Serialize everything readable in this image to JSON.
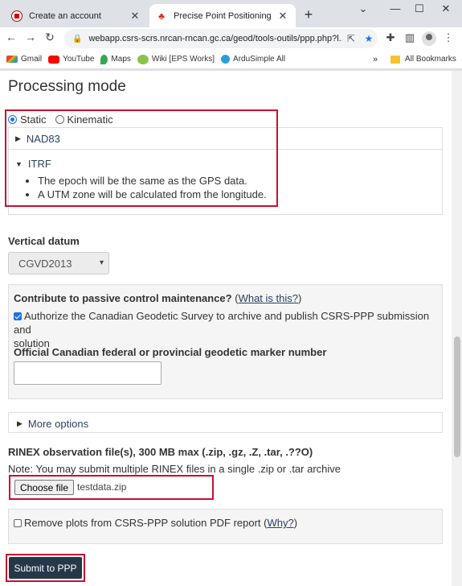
{
  "browser": {
    "tabs": [
      {
        "title": "Create an account"
      },
      {
        "title": "Precise Point Positioning"
      }
    ],
    "url": "webapp.csrs-scrs.nrcan-rncan.gc.ca/geod/tools-outils/ppp.php?l...",
    "bookmarks": [
      "Gmail",
      "YouTube",
      "Maps",
      "Wiki [EPS Works]",
      "ArduSimple All"
    ],
    "all_bookmarks": "All Bookmarks"
  },
  "page": {
    "heading": "Processing mode",
    "mode_options": {
      "static": "Static",
      "kinematic": "Kinematic"
    },
    "nad83_label": "NAD83",
    "itrf_label": "ITRF",
    "itrf_bullets": [
      "The epoch will be the same as the GPS data.",
      "A UTM zone will be calculated from the longitude."
    ],
    "vertical_datum_label": "Vertical datum",
    "vertical_datum_value": "CGVD2013",
    "contribute_heading": "Contribute to passive control maintenance?",
    "contribute_link": "What is this?",
    "authorize_text_line1": "Authorize the Canadian Geodetic Survey to archive and publish CSRS-PPP submission and",
    "authorize_text_line2": "solution",
    "marker_label": "Official Canadian federal or provincial geodetic marker number",
    "more_options": "More options",
    "rinex_label": "RINEX observation file(s), 300 MB max (.zip, .gz, .Z, .tar, .??O)",
    "rinex_note": "Note: You may submit multiple RINEX files in a single .zip or .tar archive",
    "choose_file": "Choose file",
    "file_name": "testdata.zip",
    "remove_plots_text": "Remove plots from CSRS-PPP solution PDF report (",
    "remove_plots_link": "Why?",
    "remove_plots_close": ")",
    "submit": "Submit to PPP"
  },
  "colors": {
    "highlight_red": "#c8102e",
    "link_blue": "#284162",
    "submit_bg": "#26374a"
  }
}
